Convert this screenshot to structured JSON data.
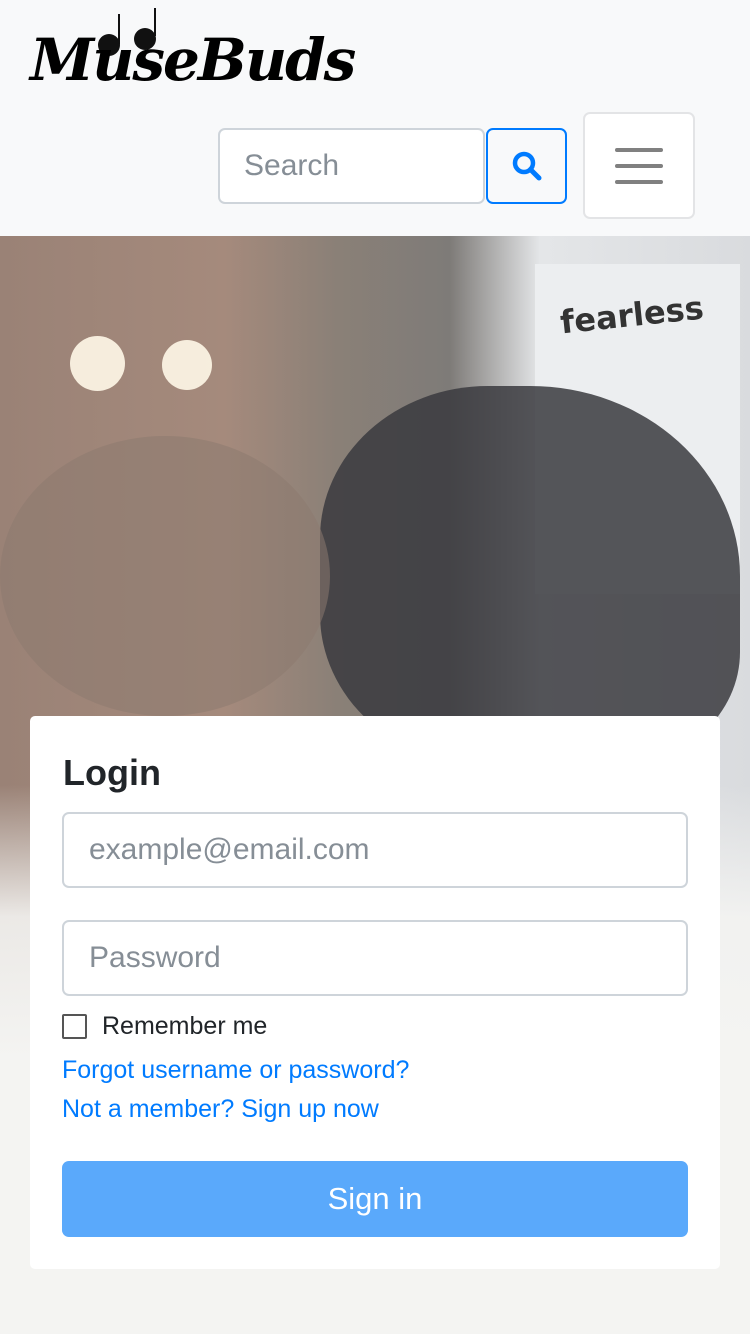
{
  "header": {
    "logo_text": "MuseBuds",
    "search": {
      "placeholder": "Search",
      "value": "",
      "icon": "search-icon"
    },
    "menu_icon": "hamburger-icon"
  },
  "hero": {
    "banner_text": "fearless"
  },
  "login": {
    "title": "Login",
    "email": {
      "placeholder": "example@email.com",
      "value": ""
    },
    "password": {
      "placeholder": "Password",
      "value": ""
    },
    "remember_label": "Remember me",
    "remember_checked": false,
    "forgot_link": "Forgot username or password?",
    "signup_link": "Not a member? Sign up now",
    "submit_label": "Sign in"
  },
  "colors": {
    "primary": "#007bff",
    "signin_button": "#5aa9fb",
    "navbar_bg": "#f8f9fa"
  }
}
